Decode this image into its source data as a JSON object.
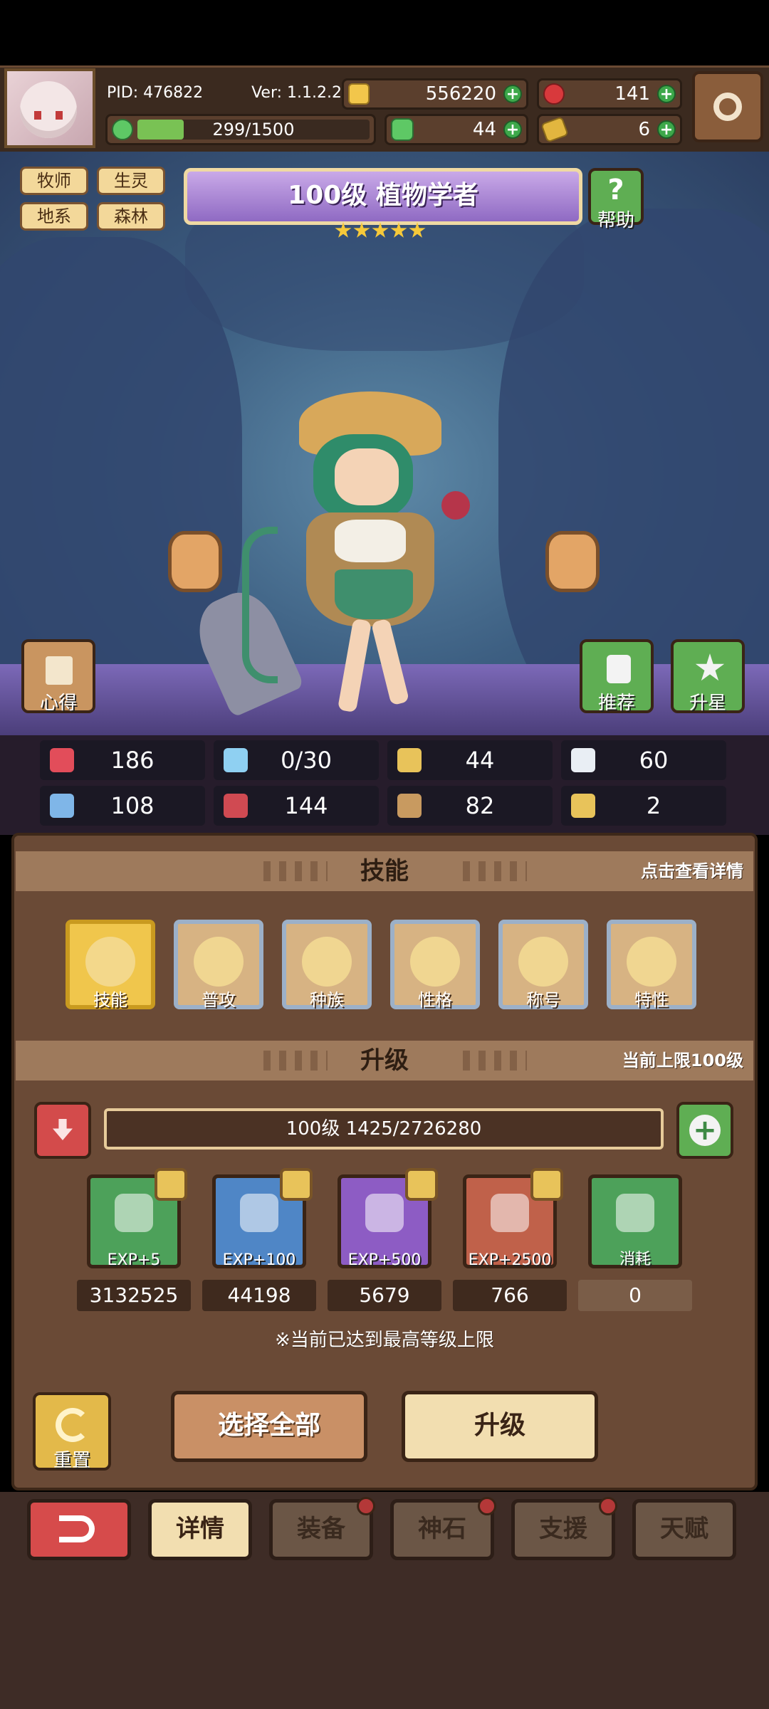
{
  "header": {
    "pid": "PID: 476822",
    "version": "Ver: 1.1.2.2",
    "exp": "299/1500",
    "exp_fraction": 0.2,
    "gold": "556220",
    "gems": "141",
    "clover": "44",
    "keys": "6"
  },
  "tags": [
    "牧师",
    "生灵",
    "地系",
    "森林"
  ],
  "title": "100级 植物学者",
  "stars": 5,
  "help_label": "帮助",
  "side_buttons": {
    "notes": "心得",
    "recommend": "推荐",
    "upstar": "升星"
  },
  "stats": [
    {
      "icon": "heart-icon",
      "color": "#e24d5a",
      "value": "186"
    },
    {
      "icon": "water-drop-icon",
      "color": "#8fd0f2",
      "value": "0/30"
    },
    {
      "icon": "shield-icon",
      "color": "#e8c35a",
      "value": "44"
    },
    {
      "icon": "wing-icon",
      "color": "#e9eef4",
      "value": "60"
    },
    {
      "icon": "fist-icon",
      "color": "#7fb6e8",
      "value": "108"
    },
    {
      "icon": "book-icon",
      "color": "#d04a52",
      "value": "144"
    },
    {
      "icon": "boots-icon",
      "color": "#c89a60",
      "value": "82"
    },
    {
      "icon": "horseshoe-icon",
      "color": "#e8c35a",
      "value": "2"
    }
  ],
  "skills_section": {
    "title": "技能",
    "hint": "点击查看详情"
  },
  "skills": [
    "技能",
    "普攻",
    "种族",
    "性格",
    "称号",
    "特性"
  ],
  "levelup_section": {
    "title": "升级",
    "hint": "当前上限100级"
  },
  "level_bar": "100级  1425/2726280",
  "exp_items": [
    {
      "label": "EXP+5",
      "count": "3132525",
      "bg": "#4da15a"
    },
    {
      "label": "EXP+100",
      "count": "44198",
      "bg": "#4f86c6"
    },
    {
      "label": "EXP+500",
      "count": "5679",
      "bg": "#8d5cc4"
    },
    {
      "label": "EXP+2500",
      "count": "766",
      "bg": "#c0614a"
    },
    {
      "label": "消耗",
      "count": "0",
      "bg": "#4da15a"
    }
  ],
  "max_notice": "※当前已达到最高等级上限",
  "reset_label": "重置",
  "select_all_label": "选择全部",
  "upgrade_label": "升级",
  "nav": [
    "详情",
    "装备",
    "神石",
    "支援",
    "天赋"
  ]
}
